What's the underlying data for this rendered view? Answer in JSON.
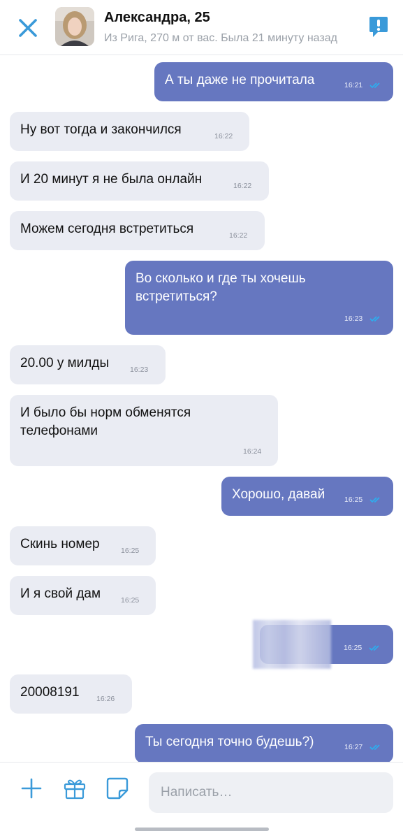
{
  "header": {
    "name": "Александра, 25",
    "subtitle": "Из Рига, 270 м от вас. Была 21 минуту назад",
    "close_icon": "close-icon",
    "report_icon": "report-icon"
  },
  "messages": [
    {
      "dir": "out",
      "text": "А ты даже не прочитала",
      "time": "16:21"
    },
    {
      "dir": "in",
      "text": "Ну вот тогда и закончился",
      "time": "16:22"
    },
    {
      "dir": "in",
      "text": "И 20 минут я не была онлайн",
      "time": "16:22"
    },
    {
      "dir": "in",
      "text": "Можем сегодня встретиться",
      "time": "16:22"
    },
    {
      "dir": "out",
      "text": "Во сколько и где ты хочешь встретиться?",
      "time": "16:23"
    },
    {
      "dir": "in",
      "text": "20.00 у милды",
      "time": "16:23"
    },
    {
      "dir": "in",
      "text": "И было бы норм обменятся телефонами",
      "time": "16:24"
    },
    {
      "dir": "out",
      "text": "Хорошо, давай",
      "time": "16:25"
    },
    {
      "dir": "in",
      "text": "Скинь номер",
      "time": "16:25"
    },
    {
      "dir": "in",
      "text": "И я свой дам",
      "time": "16:25"
    },
    {
      "dir": "out",
      "text": "",
      "time": "16:25",
      "blurred": true
    },
    {
      "dir": "in",
      "text": "20008191",
      "time": "16:26"
    },
    {
      "dir": "out",
      "text": "Ты сегодня точно будешь?)",
      "time": "16:27"
    }
  ],
  "composer": {
    "placeholder": "Написать…",
    "add_icon": "plus-icon",
    "gift_icon": "gift-icon",
    "sticker_icon": "sticker-icon"
  },
  "colors": {
    "accent": "#3a9ad9",
    "outgoing_bubble": "#6677c0",
    "incoming_bubble": "#eaecf3"
  }
}
